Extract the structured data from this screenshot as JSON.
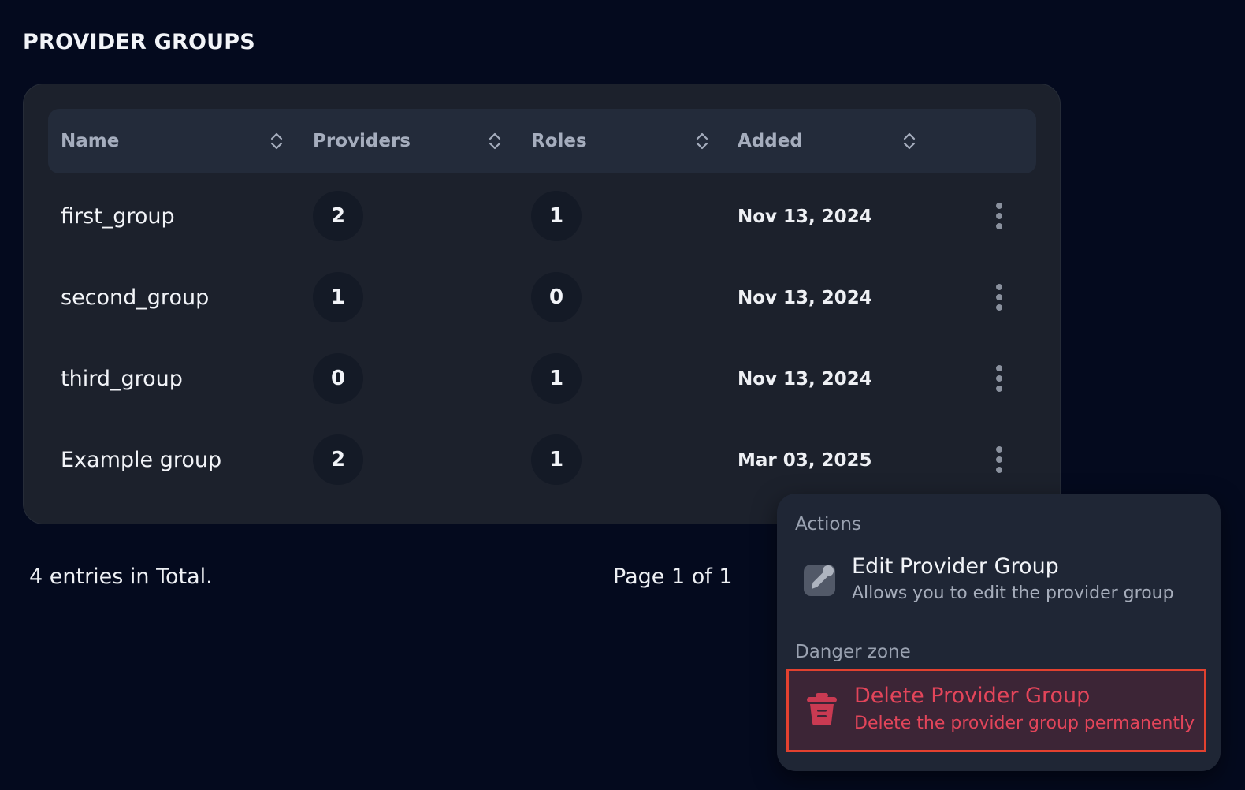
{
  "page": {
    "title": "PROVIDER GROUPS"
  },
  "table": {
    "columns": [
      {
        "label": "Name"
      },
      {
        "label": "Providers"
      },
      {
        "label": "Roles"
      },
      {
        "label": "Added"
      }
    ],
    "rows": [
      {
        "name": "first_group",
        "providers": "2",
        "roles": "1",
        "added": "Nov 13, 2024"
      },
      {
        "name": "second_group",
        "providers": "1",
        "roles": "0",
        "added": "Nov 13, 2024"
      },
      {
        "name": "third_group",
        "providers": "0",
        "roles": "1",
        "added": "Nov 13, 2024"
      },
      {
        "name": "Example group",
        "providers": "2",
        "roles": "1",
        "added": "Mar 03, 2025"
      }
    ]
  },
  "footer": {
    "total": "4 entries in Total.",
    "page": "Page 1 of 1"
  },
  "menu": {
    "actions_label": "Actions",
    "edit": {
      "title": "Edit Provider Group",
      "desc": "Allows you to edit the provider group"
    },
    "danger_label": "Danger zone",
    "delete": {
      "title": "Delete Provider Group",
      "desc": "Delete the provider group permanently"
    }
  },
  "colors": {
    "background": "#040a1e",
    "card": "#1c212c",
    "danger": "#e3455a",
    "highlight": "#e2412f"
  },
  "icons": {
    "sort": "sort-icon",
    "more": "kebab-icon",
    "edit": "pencil-icon",
    "delete": "trash-icon"
  }
}
